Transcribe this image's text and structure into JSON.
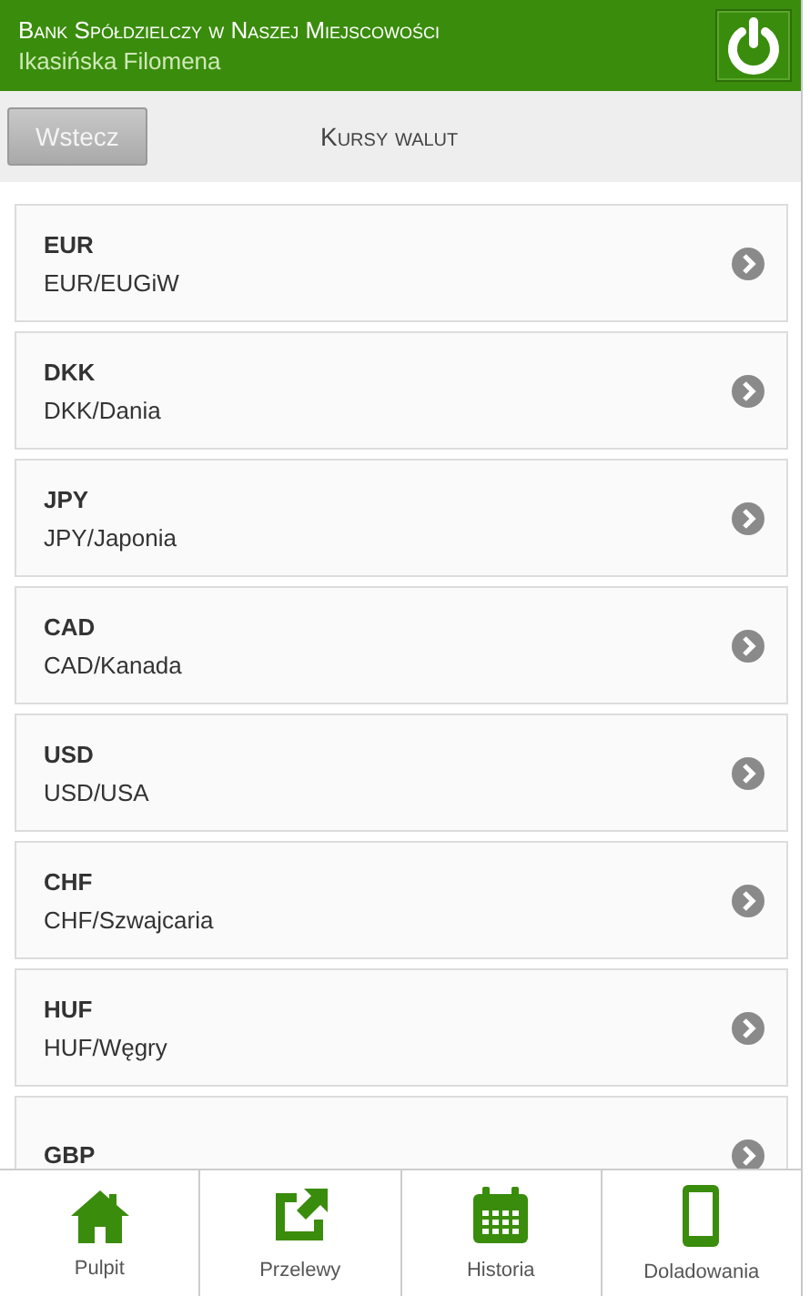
{
  "header": {
    "bank_name": "Bank Spółdzielczy w Naszej Miejscowości",
    "user_name": "Ikasińska Filomena"
  },
  "nav": {
    "back_button": "Wstecz",
    "title": "Kursy walut"
  },
  "currencies": [
    {
      "code": "EUR",
      "name": "EUR/EUGiW"
    },
    {
      "code": "DKK",
      "name": "DKK/Dania"
    },
    {
      "code": "JPY",
      "name": "JPY/Japonia"
    },
    {
      "code": "CAD",
      "name": "CAD/Kanada"
    },
    {
      "code": "USD",
      "name": "USD/USA"
    },
    {
      "code": "CHF",
      "name": "CHF/Szwajcaria"
    },
    {
      "code": "HUF",
      "name": "HUF/Węgry"
    },
    {
      "code": "GBP"
    }
  ],
  "tabs": [
    {
      "kind": "home",
      "label": "Pulpit"
    },
    {
      "kind": "transfer",
      "label": "Przelewy"
    },
    {
      "kind": "calendar",
      "label": "Historia"
    },
    {
      "kind": "phone",
      "label": "Doladowania"
    }
  ]
}
